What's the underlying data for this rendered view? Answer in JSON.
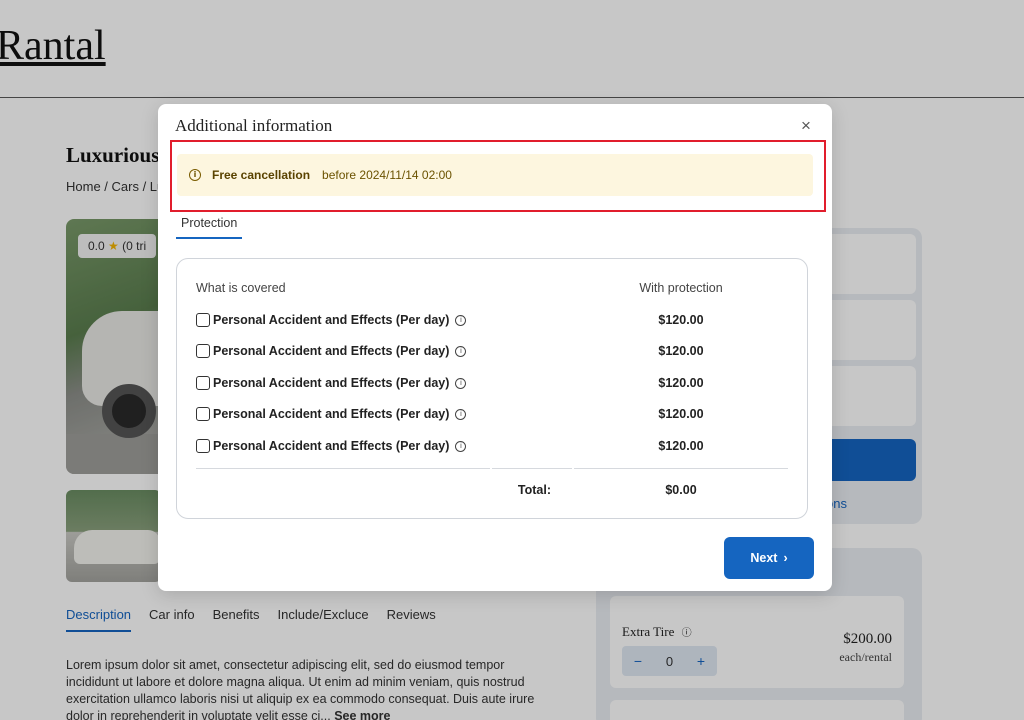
{
  "site": {
    "title": "Rantal"
  },
  "listing": {
    "title": "Luxurious",
    "breadcrumb": "Home / Cars / Lu",
    "rating": "0.0",
    "rating_count": "(0 tri"
  },
  "page_tabs": [
    "Description",
    "Car info",
    "Benefits",
    "Include/Excluce",
    "Reviews"
  ],
  "description": {
    "text": "Lorem ipsum dolor sit amet, consectetur adipiscing elit, sed do eiusmod tempor incididunt ut labore et dolore magna aliqua. Ut enim ad minim veniam, quis nostrud exercitation ullamco laboris nisi ut aliquip ex ea commodo consequat. Duis aute irure dolor in reprehenderit in voluptate velit esse ci...",
    "more": "See more"
  },
  "sidebar": {
    "link_fragment": "ons"
  },
  "extras": {
    "name": "Extra Tire",
    "price": "$200.00",
    "unit": "each/rental",
    "qty": "0",
    "minus": "−",
    "plus": "+"
  },
  "modal": {
    "title": "Additional information",
    "close": "×",
    "notice_strong": "Free cancellation",
    "notice_text": "before 2024/11/14 02:00",
    "tab": "Protection",
    "col_covered": "What is covered",
    "col_protection": "With protection",
    "rows": [
      {
        "name": "Personal Accident and Effects (Per day)",
        "price": "$120.00"
      },
      {
        "name": "Personal Accident and Effects (Per day)",
        "price": "$120.00"
      },
      {
        "name": "Personal Accident and Effects (Per day)",
        "price": "$120.00"
      },
      {
        "name": "Personal Accident and Effects (Per day)",
        "price": "$120.00"
      },
      {
        "name": "Personal Accident and Effects (Per day)",
        "price": "$120.00"
      }
    ],
    "total_label": "Total:",
    "total_value": "$0.00",
    "next_label": "Next",
    "next_chevron": "›"
  },
  "colors": {
    "accent": "#1565c0",
    "notice_bg": "#fdf6df",
    "highlight": "#e11d2c"
  }
}
